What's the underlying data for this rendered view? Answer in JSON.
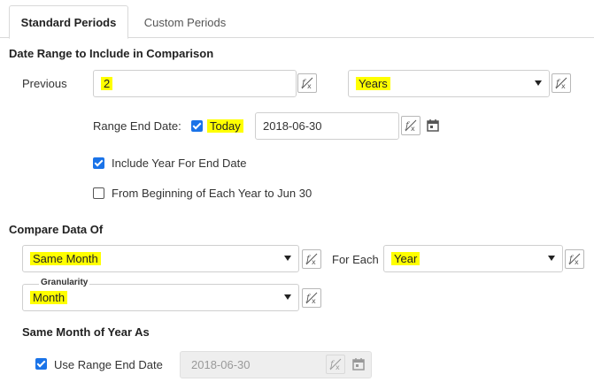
{
  "tabs": [
    {
      "label": "Standard Periods"
    },
    {
      "label": "Custom Periods"
    }
  ],
  "date_range": {
    "title": "Date Range to Include in Comparison",
    "previous_label": "Previous",
    "previous_value": "2",
    "unit_value": "Years",
    "range_end_label": "Range End Date:",
    "today_label": "Today",
    "end_date_value": "2018-06-30",
    "include_year_label": "Include Year For End Date",
    "from_beginning_label": "From Beginning of Each Year to Jun 30"
  },
  "compare": {
    "title": "Compare Data Of",
    "compare_value": "Same Month",
    "for_each_label": "For Each",
    "for_each_value": "Year",
    "granularity_label": "Granularity",
    "granularity_value": "Month"
  },
  "same_month": {
    "title": "Same Month of Year As",
    "use_range_label": "Use Range End Date",
    "date_value": "2018-06-30"
  },
  "icons": {
    "formula": "formula-icon",
    "calendar": "calendar-icon",
    "dropdown": "chevron-down-icon",
    "checkbox": "checkbox-icon"
  },
  "colors": {
    "highlight": "#ffff00",
    "checkbox": "#1a73e8"
  }
}
